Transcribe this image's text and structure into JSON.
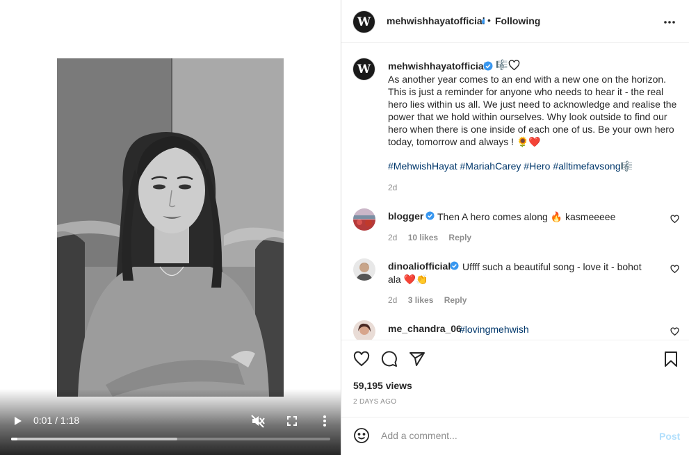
{
  "video": {
    "time_display": "0:01 / 1:18",
    "progress_played": 0.02,
    "progress_buffered": 0.52
  },
  "header": {
    "username": "mehwishhayatofficial",
    "separator": "•",
    "follow_status": "Following",
    "avatar_letter": "W"
  },
  "caption": {
    "username": "mehwishhayatofficial",
    "music_emoji": "🎼",
    "text": "As another year comes to an end with a new one on the horizon. This is just a reminder for anyone who needs to hear it - the real hero lies within us all. We just need to acknowledge and realise the power that we hold within ourselves. Why look outside to find our hero when there is one inside of each one of us. Be your own hero today, tomorrow and always !",
    "emojis_end": "🌻❤️",
    "hashtags": "#MehwishHayat #MariahCarey #Hero #alltimefavsong🎼",
    "time": "2d"
  },
  "comments": [
    {
      "username": "blogger",
      "text": "Then A hero comes along",
      "emoji": "🔥",
      "text_after": "kasmeeeee",
      "time": "2d",
      "likes": "10 likes",
      "reply": "Reply"
    },
    {
      "username": "dinoaliofficial",
      "text": "Uffff such a beautiful song - love it - bohot ala",
      "emoji": "❤️👏",
      "time": "2d",
      "likes": "3 likes",
      "reply": "Reply"
    },
    {
      "username": "me_chandra_06",
      "text": "#lovingmehwish"
    }
  ],
  "stats": {
    "views": "59,195 views",
    "date": "2 DAYS AGO"
  },
  "add_comment": {
    "placeholder": "Add a comment...",
    "post_label": "Post"
  },
  "colors": {
    "verified": "#3897f0",
    "link": "#00376b",
    "post_disabled": "#b2dffc"
  }
}
